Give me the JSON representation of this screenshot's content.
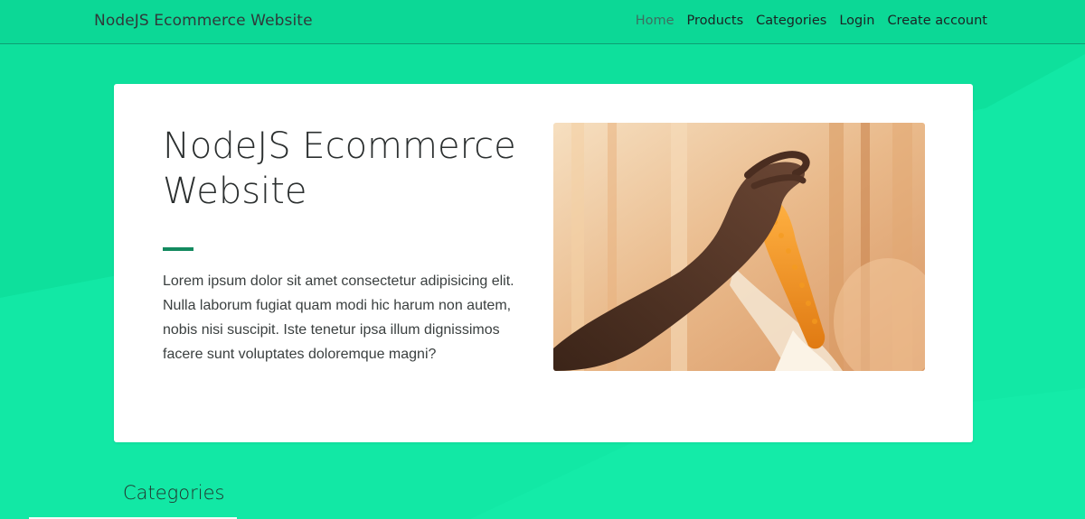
{
  "brand": "NodeJS Ecommerce Website",
  "nav": {
    "items": [
      {
        "label": "Home",
        "active": true
      },
      {
        "label": "Products",
        "active": false
      },
      {
        "label": "Categories",
        "active": false
      },
      {
        "label": "Login",
        "active": false
      },
      {
        "label": "Create account",
        "active": false
      }
    ]
  },
  "hero": {
    "title": "NodeJS Ecommerce Website",
    "text": "Lorem ipsum dolor sit amet consectetur adipisicing elit. Nulla laborum fugiat quam modi hic harum non autem, nobis nisi suscipit. Iste tenetur ipsa illum dignissimos facere sunt voluptates doloremque magni?",
    "image": "hand-holding-corn-cob"
  },
  "section": {
    "title": "Categories"
  },
  "colors": {
    "background": "#12e7a3",
    "accent": "#138a5f",
    "nav_active": "#3c6f61"
  }
}
